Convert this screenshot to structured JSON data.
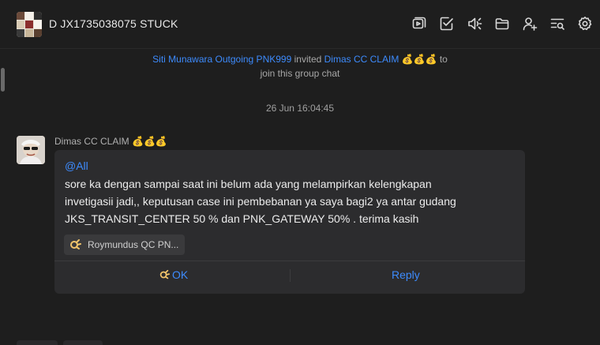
{
  "header": {
    "title": "D JX1735038075 STUCK",
    "icons": [
      "video-icon",
      "checklist-icon",
      "speaker-icon",
      "folder-icon",
      "add-member-icon",
      "search-list-icon",
      "settings-icon"
    ]
  },
  "system_message": {
    "inviter": "Siti Munawara Outgoing PNK999",
    "invited_text": "invited",
    "invitee": "Dimas CC CLAIM 💰💰💰",
    "tail": "to",
    "line2": "join this group chat"
  },
  "date_separator": "26 Jun 16:04:45",
  "message": {
    "sender": "Dimas CC CLAIM 💰💰💰",
    "mention": "@All",
    "lines": [
      "sore ka dengan sampai saat ini belum ada yang melampirkan kelengkapan",
      "invetigasii jadi,, keputusan case ini pembebanan ya saya bagi2 ya antar gudang",
      "JKS_TRANSIT_CENTER 50 % dan PNK_GATEWAY 50% . terima kasih"
    ],
    "reaction_user": "Roymundus QC PN...",
    "ok_label": "OK",
    "reply_label": "Reply"
  },
  "colors": {
    "background": "#1e1e1e",
    "bubble": "#2c2c2e",
    "link": "#3d8bfd"
  }
}
